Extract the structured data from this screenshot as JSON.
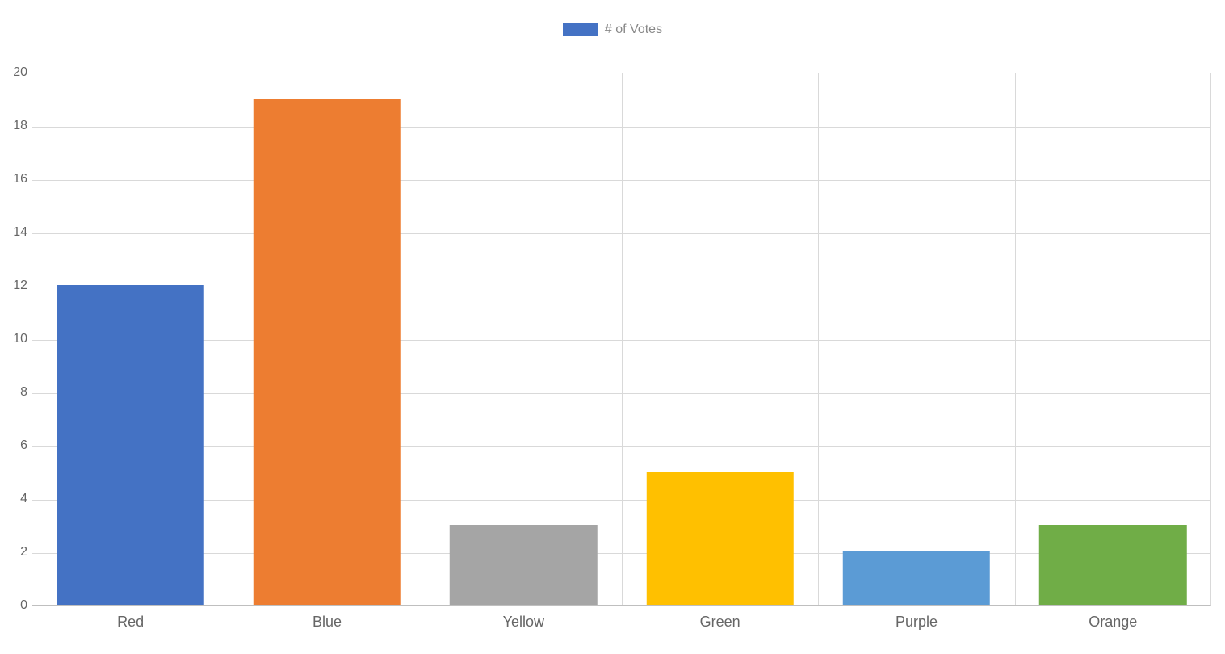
{
  "chart_data": {
    "type": "bar",
    "legend_label": "# of Votes",
    "categories": [
      "Red",
      "Blue",
      "Yellow",
      "Green",
      "Purple",
      "Orange"
    ],
    "values": [
      12,
      19,
      3,
      5,
      2,
      3
    ],
    "bar_colors": [
      "#4472c4",
      "#ed7d31",
      "#a5a5a5",
      "#ffc000",
      "#5b9bd5",
      "#70ad47"
    ],
    "legend_swatch_color": "#4472c4",
    "y_ticks": [
      0,
      2,
      4,
      6,
      8,
      10,
      12,
      14,
      16,
      18,
      20
    ],
    "ylim": [
      0,
      20
    ],
    "xlabel": "",
    "ylabel": "",
    "title": ""
  }
}
